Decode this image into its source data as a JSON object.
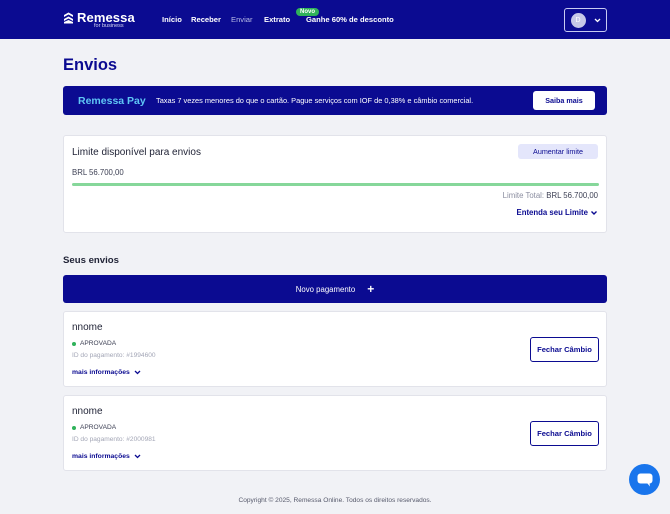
{
  "header": {
    "logo_text": "Remessa",
    "logo_sub": "for business",
    "nav": [
      {
        "label": "Início"
      },
      {
        "label": "Receber"
      },
      {
        "label": "Enviar"
      },
      {
        "label": "Extrato"
      },
      {
        "label": "Ganhe 60% de desconto"
      }
    ],
    "badge_new": "Novo",
    "avatar_initial": "D"
  },
  "page_title": "Envios",
  "promo": {
    "brand": "Remessa Pay",
    "text": "Taxas 7 vezes menores do que o cartão. Pague serviços com IOF de 0,38% e câmbio comercial.",
    "button": "Saiba mais"
  },
  "limit": {
    "title": "Limite disponível para envios",
    "button": "Aumentar limite",
    "value": "BRL 56.700,00",
    "total_label": "Limite Total:",
    "total_value": "BRL 56.700,00",
    "progress": 1.0,
    "link": "Entenda seu Limite"
  },
  "section_title": "Seus envios",
  "new_payment": "Novo pagamento",
  "payments": [
    {
      "name": "nnome",
      "status": "APROVADA",
      "id": "ID do pagamento: #1994600",
      "more": "mais informações",
      "button": "Fechar Câmbio"
    },
    {
      "name": "nnome",
      "status": "APROVADA",
      "id": "ID do pagamento: #2000981",
      "more": "mais informações",
      "button": "Fechar Câmbio"
    }
  ],
  "footer": "Copyright © 2025, Remessa Online. Todos os direitos reservados.",
  "colors": {
    "primary": "#0b0b91",
    "accent_light": "#5fc7f5",
    "success": "#2fb25a",
    "chat": "#1975ec",
    "background": "#f1f2f6"
  },
  "icons": [
    "remessa-logo-icon",
    "chevron-down-icon",
    "plus-icon",
    "chat-icon",
    "status-dot-icon"
  ]
}
